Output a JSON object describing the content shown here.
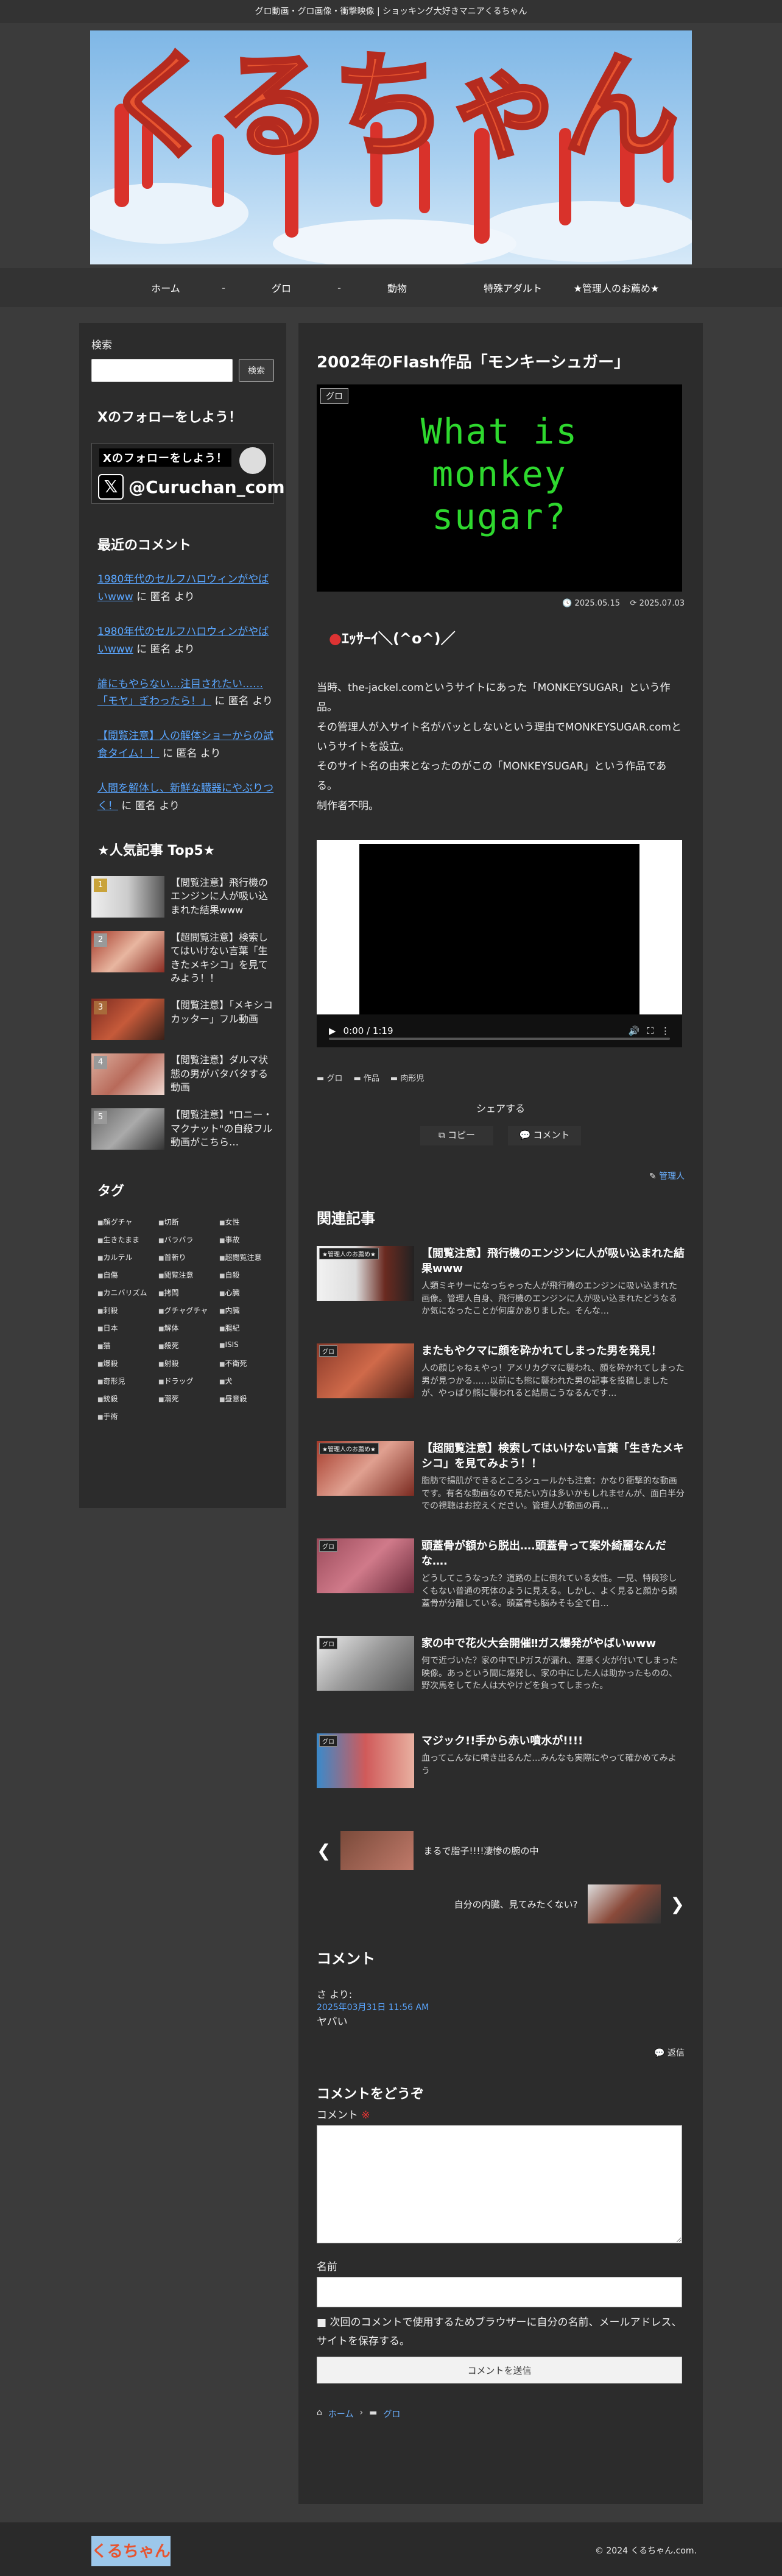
{
  "site": {
    "tagline": "グロ動画・グロ画像・衝撃映像 | ショッキング大好きマニアくるちゃん",
    "logo_text": "くるちゃん",
    "copyright": "© 2024 くるちゃん.com."
  },
  "nav": {
    "items": [
      "ホーム",
      "グロ",
      "動物",
      "特殊アダルト",
      "★管理人のお薦め★"
    ],
    "separator": "-"
  },
  "sidebar": {
    "search_label": "検索",
    "search_placeholder": "",
    "search_button": "検索",
    "follow_title": "Xのフォローをしよう！",
    "follow_banner_top": "Xのフォローをしよう！",
    "follow_banner_handle": "@Curuchan_com",
    "recent_comments_title": "最近のコメント",
    "recent_comments": [
      {
        "link": "1980年代のセルフハロウィンがやばいwww",
        "suffix": " に 匿名 より"
      },
      {
        "link": "1980年代のセルフハロウィンがやばいwww",
        "suffix": " に 匿名 より"
      },
      {
        "link": "誰にもやらない…注目されたい……「モヤ」ぎわったら！」",
        "suffix": " に 匿名 より"
      },
      {
        "link": "【閲覧注意】人の解体ショーからの試食タイム！！",
        "suffix": " に 匿名 より"
      },
      {
        "link": "人間を解体し、新鮮な臓器にやぶりつく！",
        "suffix": " に 匿名 より"
      }
    ],
    "popular_title": "★人気記事 Top5★",
    "popular": [
      {
        "rank": "1",
        "title": "【閲覧注意】飛行機のエンジンに人が吸い込まれた結果www"
      },
      {
        "rank": "2",
        "title": "【超閲覧注意】検索してはいけない言葉「生きたメキシコ」を見てみよう！！"
      },
      {
        "rank": "3",
        "title": "【閲覧注意】「メキシコ カッター」フル動画"
      },
      {
        "rank": "4",
        "title": "【閲覧注意】ダルマ状態の男がバタバタする動画"
      },
      {
        "rank": "5",
        "title": "【閲覧注意】\"ロニー・マクナット\"の自殺フル動画がこちら…"
      }
    ],
    "tags_title": "タグ",
    "tags": [
      "顔グチャ",
      "切断",
      "女性",
      "生きたまま",
      "バラバラ",
      "事故",
      "カルテル",
      "首斬り",
      "超閲覧注意",
      "自傷",
      "閲覧注意",
      "自殺",
      "カニバリズム",
      "拷問",
      "心臓",
      "刺殺",
      "グチャグチャ",
      "内臓",
      "日本",
      "解体",
      "腸紀",
      "猫",
      "殺死",
      "ISIS",
      "爆殺",
      "射殺",
      "不衛死",
      "奇形児",
      "ドラッグ",
      "犬",
      "銃殺",
      "溺死",
      "昼意殺",
      "手術"
    ]
  },
  "article": {
    "title": "2002年のFlash作品「モンキーシュガー」",
    "category": "グロ",
    "eyecatch_lines": [
      "What is",
      "monkey",
      "sugar?"
    ],
    "published": "2025.05.15",
    "updated": "2025.07.03",
    "emote": "ｴｯｻｰｲ＼(^o^)／",
    "body": [
      "当時、the-jackel.comというサイトにあった「MONKEYSUGAR」という作品。",
      "その管理人が入サイト名がバッとしないという理由でMONKEYSUGAR.comというサイトを設立。",
      "そのサイト名の由来となったのがこの「MONKEYSUGAR」という作品である。",
      "制作者不明。"
    ],
    "video_time": "0:00 / 1:19",
    "tags": [
      "グロ",
      "作品",
      "肉形児"
    ],
    "share_label": "シェアする",
    "copy_label": "コピー",
    "comment_label": "コメント",
    "author": "管理人"
  },
  "related": {
    "title": "関連記事",
    "items": [
      {
        "label": "★管理人のお薦め★",
        "title": "【閲覧注意】飛行機のエンジンに人が吸い込まれた結果www",
        "snippet": "人類ミキサーになっちゃった人が飛行機のエンジンに吸い込まれた画像。管理人自身、飛行機のエンジンに人が吸い込まれたどうなるか気になったことが何度かありました。そんな…"
      },
      {
        "label": "グロ",
        "title": "またもやクマに顔を砕かれてしまった男を発見！",
        "snippet": "人の顔じゃねぇやっ！アメリカグマに襲われ、顔を砕かれてしまった男が見つかる……以前にも熊に襲われた男の記事を投稿しましたが、やっぱり熊に襲われると結局こうなるんです…"
      },
      {
        "label": "★管理人のお薦め★",
        "title": "【超閲覧注意】検索してはいけない言葉「生きたメキシコ」を見てみよう！！",
        "snippet": "脂肪で揚肌ができるところシュールかも注意：かなり衝撃的な動画です。有名な動画なので見たい方は多いかもしれませんが、面白半分での視聴はお控えください。管理人が動画の再…"
      },
      {
        "label": "グロ",
        "title": "頭蓋骨が額から脱出….頭蓋骨って案外綺麗なんだな….",
        "snippet": "どうしてこうなった？道路の上に倒れている女性。一見、特段珍しくもない普通の死体のように見える。しかし、よく見ると顔から頭蓋骨が分離している。頭蓋骨も脳みそも全て自…"
      },
      {
        "label": "グロ",
        "title": "家の中で花火大会開催‼︎ガス爆発がやばいwww",
        "snippet": "何で近づいた？家の中でLPガスが漏れ、運悪く火が付いてしまった映像。あっという間に爆発し、家の中にした人は助かったものの、野次馬をしてた人は大やけどを負ってしまった。"
      },
      {
        "label": "グロ",
        "title": "マジック!!手から赤い噴水が!!!!",
        "snippet": "血ってこんなに噴き出るんだ…みんなも実際にやって確かめてみよう"
      }
    ]
  },
  "prevnext": {
    "prev_title": "まるで脂子!!!!凄惨の腕の中",
    "next_title": "自分の内臓、見てみたくない?"
  },
  "comments": {
    "title": "コメント",
    "items": [
      {
        "author": "さ より:",
        "date": "2025年03月31日 11:56 AM",
        "body": "ヤバい",
        "reply": "返信"
      }
    ],
    "form_title": "コメントをどうぞ",
    "comment_label": "コメント",
    "required_mark": "※",
    "name_label": "名前",
    "save_label": "次回のコメントで使用するためブラウザーに自分の名前、メールアドレス、サイトを保存する。",
    "submit_label": "コメントを送信"
  },
  "breadcrumb": [
    "ホーム",
    "グロ"
  ]
}
